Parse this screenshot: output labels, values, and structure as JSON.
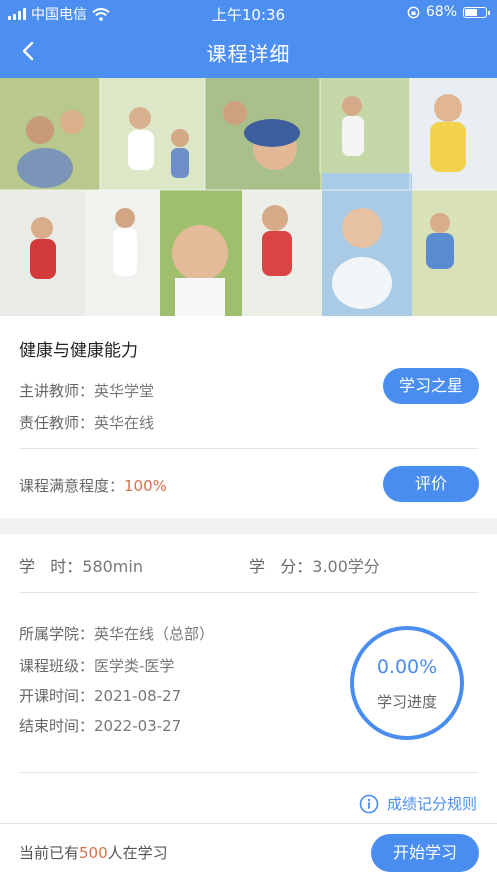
{
  "status_bar": {
    "carrier": "中国电信",
    "time": "上午10:36",
    "battery": "68%",
    "battery_level": 0.68
  },
  "nav": {
    "title": "课程详细",
    "back_icon": "chevron-left-icon"
  },
  "banner": {
    "image": "collage of family photos"
  },
  "course": {
    "title": "健康与健康能力",
    "lead_teacher_label": "主讲教师：",
    "lead_teacher": "英华学堂",
    "responsible_teacher_label": "责任教师：",
    "responsible_teacher": "英华在线",
    "study_star_button": "学习之星",
    "satisfaction_label": "课程满意程度：",
    "satisfaction": "100%",
    "review_button": "评价"
  },
  "details": {
    "hours_label": "学   时：",
    "hours": "580min",
    "credits_label": "学   分：",
    "credits": "3.00学分",
    "college_label": "所属学院：",
    "college": "英华在线（总部）",
    "class_label": "课程班级：",
    "class": "医学类-医学",
    "start_label": "开课时间：",
    "start": "2021-08-27",
    "end_label": "结束时间：",
    "end": "2022-03-27",
    "progress_value": "0.00%",
    "progress_fraction": 0.0,
    "progress_label": "学习进度",
    "rules_link": "成绩记分规则",
    "rules_icon": "info-circle-icon"
  },
  "footer": {
    "learners_prefix": "当前已有",
    "learners_count": "500",
    "learners_suffix": "人在学习",
    "start_button": "开始学习"
  },
  "colors": {
    "primary": "#4a8df0",
    "header": "#4d8ff0",
    "accent": "#d8704e"
  }
}
